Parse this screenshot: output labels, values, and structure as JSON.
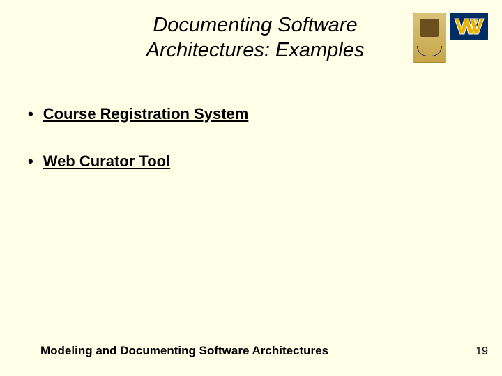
{
  "title_line1": "Documenting Software",
  "title_line2": "Architectures: Examples",
  "bullets": [
    {
      "text": "Course Registration System"
    },
    {
      "text": "Web Curator Tool"
    }
  ],
  "footer_text": "Modeling and Documenting Software Architectures",
  "page_number": "19",
  "logos": {
    "cairo_univ": "cairo-university-crest",
    "wvu": "wvu-flying-wv"
  }
}
